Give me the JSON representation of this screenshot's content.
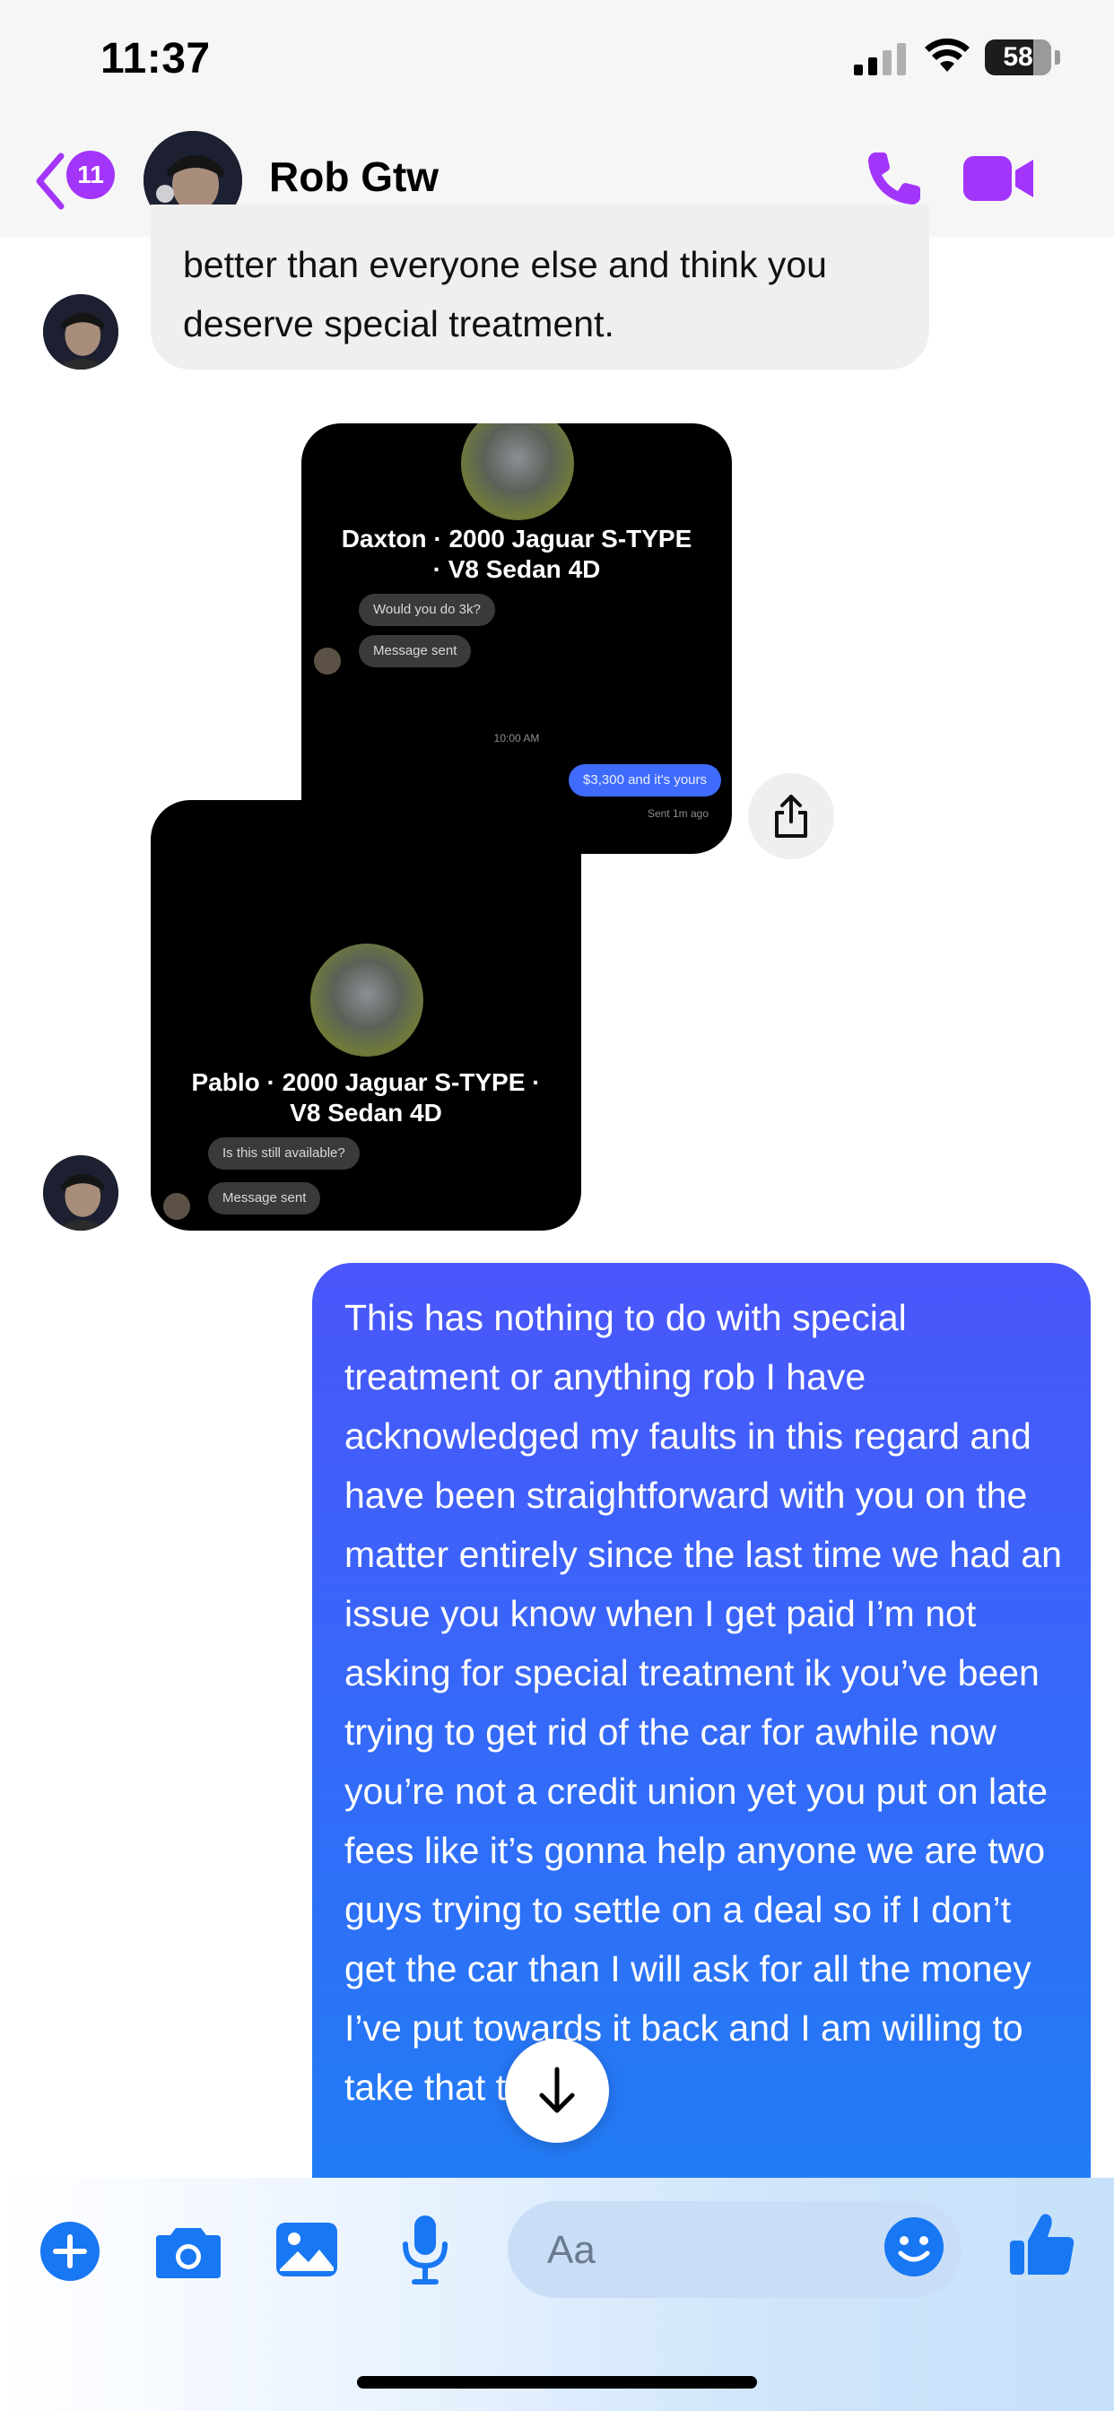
{
  "status_bar": {
    "time": "11:37",
    "battery": "58"
  },
  "header": {
    "back_badge": "11",
    "contact_name": "Rob Gtw"
  },
  "messages": {
    "incoming_text": "better than everyone else and think you deserve special treatment.",
    "screenshot_1": {
      "title": "Daxton · 2000 Jaguar S-TYPE · V8 Sedan 4D",
      "msg_in": "Would you do 3k?",
      "msg_sent": "Message sent",
      "timestamp": "10:00 AM",
      "msg_out": "$3,300 and it's yours",
      "sent_note": "Sent 1m ago"
    },
    "screenshot_2": {
      "title": "Pablo · 2000 Jaguar S-TYPE · V8 Sedan 4D",
      "msg_in": "Is this still available?",
      "msg_sent": "Message sent"
    },
    "outgoing_text": "This has nothing to do with special treatment or anything rob I have acknowledged my faults in this regard and have been straightforward with you on the matter entirely since the last time we had an issue you know when I get paid I’m not asking for special treatment ik you’ve been trying to get rid of the car for awhile now you’re not a credit union yet you put on late fees like it’s gonna help anyone we are two guys trying to settle on a deal so if I don’t get the car than I will ask for all the money I’ve put towards it back and I am willing to take that to"
  },
  "composer": {
    "placeholder": "Aa"
  },
  "colors": {
    "accent_purple": "#a334fa",
    "messenger_blue": "#2f6ef8",
    "icon_blue": "#1877f2"
  },
  "icons": [
    "back-arrow-icon",
    "phone-icon",
    "video-camera-icon",
    "share-icon",
    "arrow-down-icon",
    "plus-icon",
    "camera-icon",
    "gallery-icon",
    "microphone-icon",
    "emoji-icon",
    "thumbs-up-icon"
  ]
}
